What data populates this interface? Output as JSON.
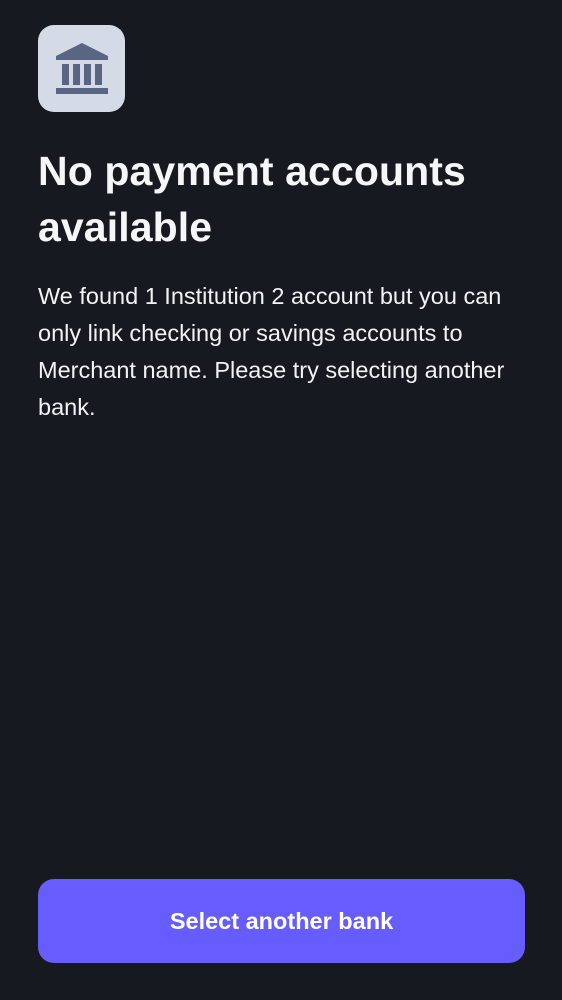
{
  "header": {
    "icon": "bank-icon",
    "icon_color": "#5a6584",
    "tile_color": "#d5dbe6"
  },
  "main": {
    "title": "No payment accounts available",
    "message": "We found 1 Institution 2 account but you can only link checking or savings accounts to Merchant name. Please try selecting another bank."
  },
  "footer": {
    "primary_button_label": "Select another bank",
    "primary_color": "#675dff"
  },
  "theme": {
    "background": "#171920",
    "text": "#f5f6f8"
  }
}
